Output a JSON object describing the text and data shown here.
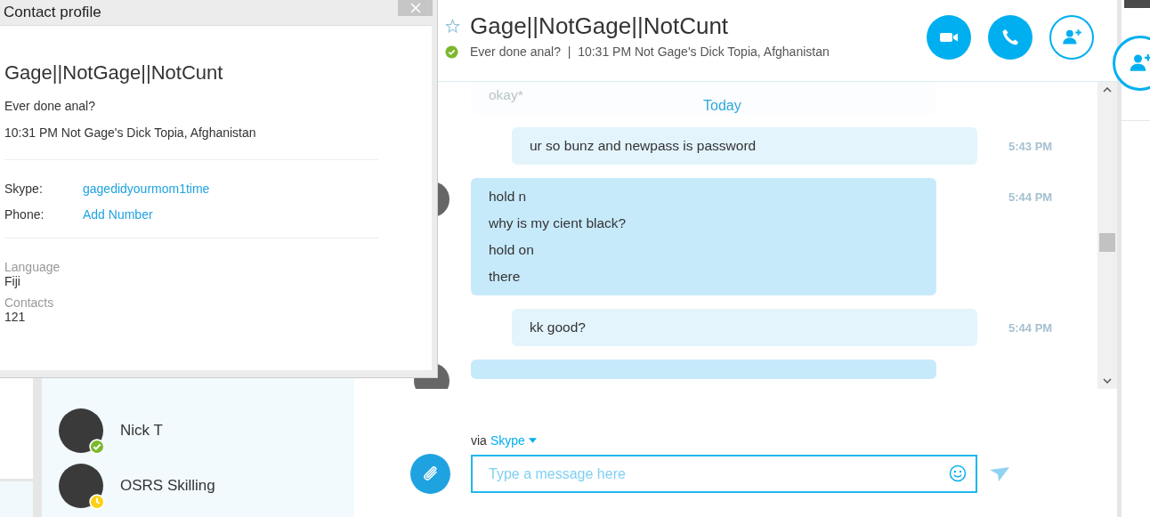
{
  "profile_dialog": {
    "title": "Contact profile",
    "name": "Gage||NotGage||NotCunt",
    "mood": "Ever done anal?",
    "location": "10:31 PM Not Gage's Dick Topia, Afghanistan",
    "fields": [
      {
        "label": "Skype:",
        "value": "gagedidyourmom1time"
      },
      {
        "label": "Phone:",
        "value": "Add Number"
      }
    ],
    "details": [
      {
        "label": "Language",
        "value": "Fiji"
      },
      {
        "label": "Contacts",
        "value": "121"
      }
    ]
  },
  "contacts": [
    {
      "name": "Nick T",
      "kind": "online"
    },
    {
      "name": "OSRS Skilling",
      "kind": "away"
    }
  ],
  "chat": {
    "title": "Gage||NotGage||NotCunt",
    "favorite": false,
    "online": true,
    "status_line": "Ever done anal?  |  10:31 PM Not Gage's Dick Topia, Afghanistan",
    "date_divider": "Today",
    "messages": [
      {
        "kind": "faded",
        "lines": [
          "okay*"
        ]
      },
      {
        "kind": "outgoing",
        "lines": [
          "ur so bunz and newpass is password"
        ],
        "time": "5:43 PM"
      },
      {
        "kind": "incoming",
        "lines": [
          "hold n",
          "why is my cient black?",
          "hold on",
          "there"
        ],
        "time": "5:44 PM"
      },
      {
        "kind": "outgoing",
        "lines": [
          "kk good?"
        ],
        "time": "5:44 PM"
      }
    ],
    "via_label": "via",
    "via_service": "Skype",
    "placeholder": "Type a message here"
  }
}
